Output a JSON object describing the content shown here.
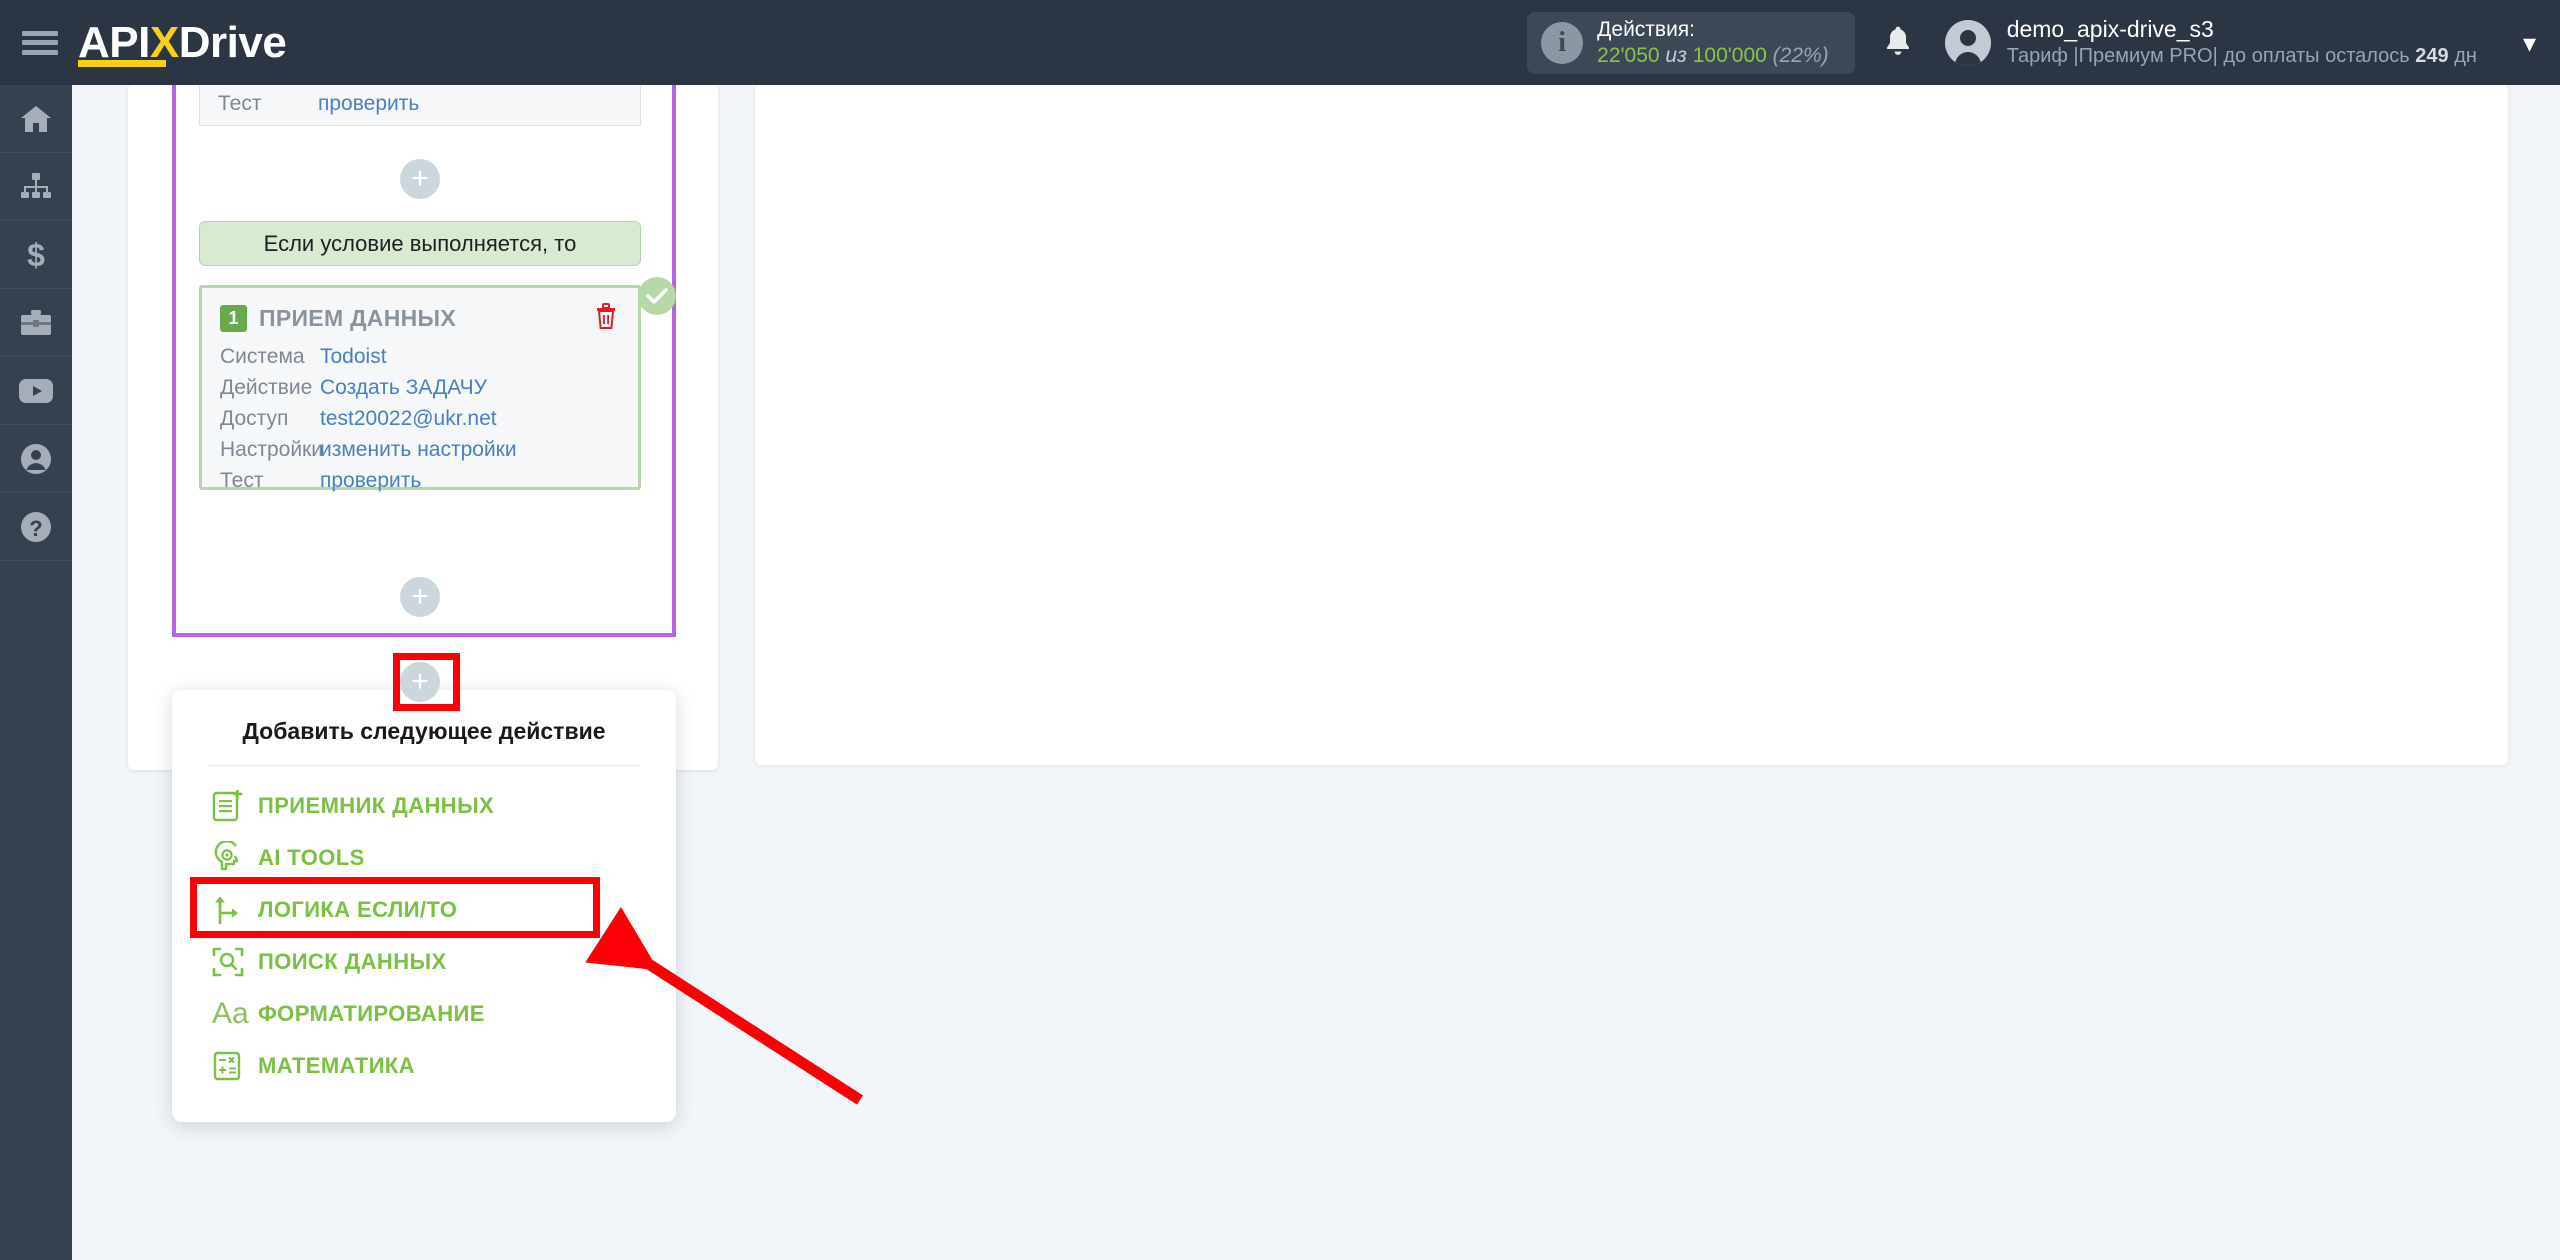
{
  "header": {
    "menu_icon": "hamburger-icon",
    "logo": {
      "part1": "API",
      "part2": "X",
      "part3": "Drive"
    },
    "actions": {
      "title": "Действия:",
      "used": "22'050",
      "of": "из",
      "total": "100'000",
      "percent": "(22%)"
    },
    "notifications_icon": "bell-icon",
    "user": {
      "name": "demo_apix-drive_s3",
      "plan_prefix": "Тариф |Премиум PRO| до оплаты осталось",
      "days_value": "249",
      "days_unit": "дн"
    },
    "dropdown_icon": "chevron-down-icon"
  },
  "sidebar": {
    "items": [
      {
        "name": "home-icon",
        "label": "Главная"
      },
      {
        "name": "connections-icon",
        "label": "Связи"
      },
      {
        "name": "billing-icon",
        "label": "Оплата"
      },
      {
        "name": "briefcase-icon",
        "label": "Партнёрам"
      },
      {
        "name": "youtube-icon",
        "label": "Видео"
      },
      {
        "name": "account-icon",
        "label": "Аккаунт"
      },
      {
        "name": "help-icon",
        "label": "Помощь"
      }
    ]
  },
  "flow": {
    "top_card": {
      "rows": [
        {
          "label": "Тест",
          "value": "проверить"
        }
      ]
    },
    "add_mid_label": "+",
    "condition_bar": "Если условие выполняется, то",
    "data_card": {
      "badge": "1",
      "title": "ПРИЕМ ДАННЫХ",
      "delete_icon": "trash-icon",
      "status_icon": "check-circle-icon",
      "rows": [
        {
          "label": "Система",
          "value": "Todoist"
        },
        {
          "label": "Действие",
          "value": "Создать ЗАДАЧУ"
        },
        {
          "label": "Доступ",
          "value": "test20022@ukr.net"
        },
        {
          "label": "Настройки",
          "value": "изменить настройки"
        },
        {
          "label": "Тест",
          "value": "проверить"
        }
      ]
    },
    "add_low_label": "+",
    "add_next_label": "+"
  },
  "dropdown": {
    "title": "Добавить следующее действие",
    "items": [
      {
        "icon": "document-add-icon",
        "label": "ПРИЕМНИК ДАННЫХ"
      },
      {
        "icon": "ai-brain-icon",
        "label": "AI TOOLS"
      },
      {
        "icon": "branch-logic-icon",
        "label": "ЛОГИКА ЕСЛИ/ТО"
      },
      {
        "icon": "search-scan-icon",
        "label": "ПОИСК ДАННЫХ"
      },
      {
        "icon": "text-format-icon",
        "label": "ФОРМАТИРОВАНИЕ"
      },
      {
        "icon": "calculator-icon",
        "label": "МАТЕМАТИКА"
      }
    ]
  },
  "annotations": {
    "highlight_plus": "add-action-button-highlight",
    "highlight_logic": "logic-if-then-highlight",
    "arrow": "pointer-arrow"
  },
  "colors": {
    "header_bg": "#2b3543",
    "rail_bg": "#36414f",
    "accent_green": "#7ac143",
    "accent_yellow": "#f7d117",
    "purple_border": "#b563e0",
    "annotation_red": "#fb0007",
    "link_blue": "#4a7fc1",
    "page_bg": "#f2f5fa"
  }
}
